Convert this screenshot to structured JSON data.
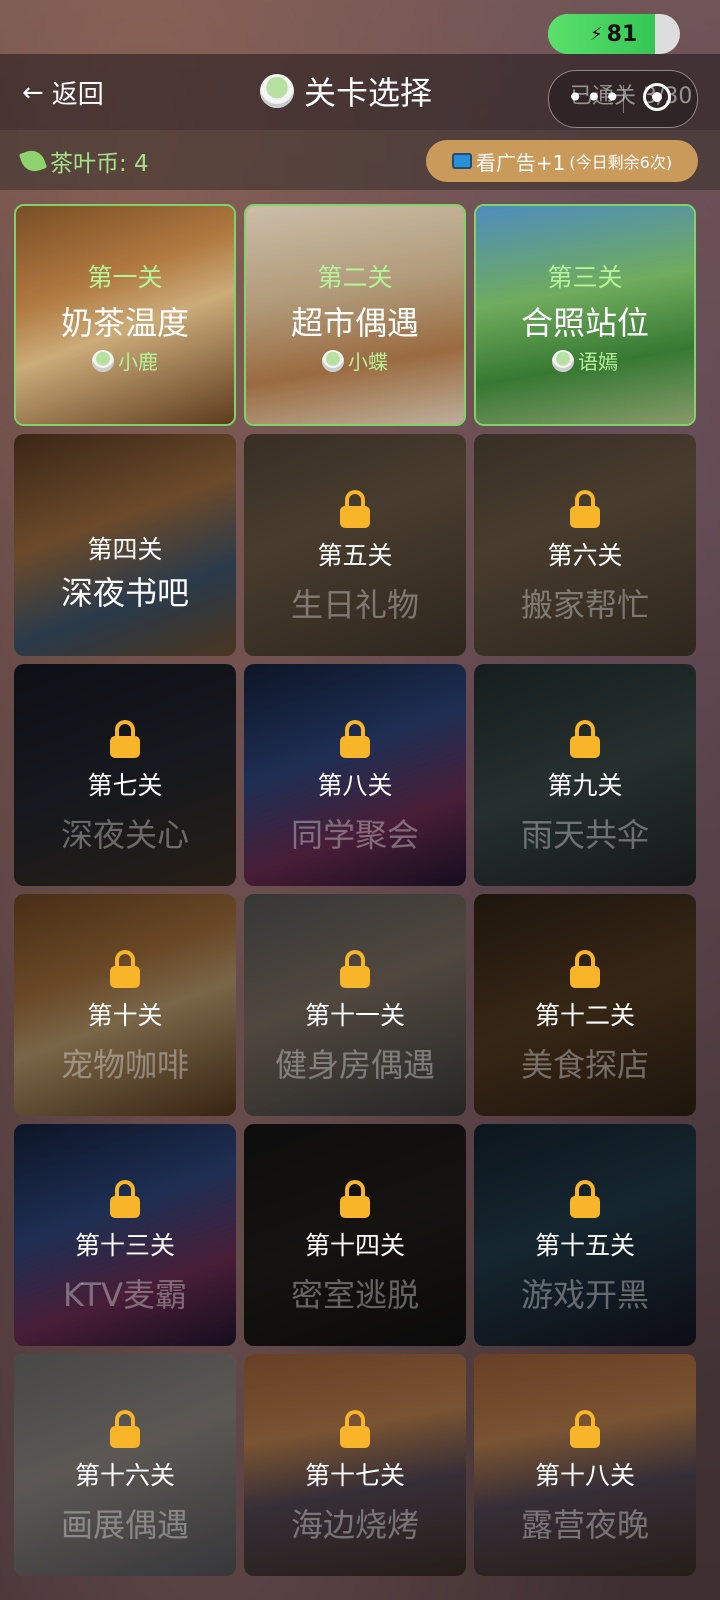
{
  "status": {
    "battery": "81",
    "battery_level": 0.81
  },
  "header": {
    "back_label": "返回",
    "back_icon": "arrow-left-icon",
    "title": "关卡选择",
    "progress": "已通关 3/30",
    "more_icon": "more-dots-icon",
    "target_icon": "miniprogram-close-icon"
  },
  "subbar": {
    "coins": "茶叶币: 4",
    "ad_label": "看广告+1",
    "ad_note": "(今日剩余6次)"
  },
  "levels": [
    {
      "num": "第一关",
      "name": "奶茶温度",
      "char": "小鹿",
      "state": "unlocked",
      "scene": "cafe-window"
    },
    {
      "num": "第二关",
      "name": "超市偶遇",
      "char": "小蝶",
      "state": "unlocked",
      "scene": "supermarket"
    },
    {
      "num": "第三关",
      "name": "合照站位",
      "char": "语嫣",
      "state": "unlocked",
      "scene": "park"
    },
    {
      "num": "第四关",
      "name": "深夜书吧",
      "state": "current",
      "scene": "night-library"
    },
    {
      "num": "第五关",
      "name": "生日礼物",
      "state": "locked",
      "scene": "living-room"
    },
    {
      "num": "第六关",
      "name": "搬家帮忙",
      "state": "locked",
      "scene": "living-room"
    },
    {
      "num": "第七关",
      "name": "深夜关心",
      "state": "locked",
      "scene": "night-room"
    },
    {
      "num": "第八关",
      "name": "同学聚会",
      "state": "locked",
      "scene": "ktv"
    },
    {
      "num": "第九关",
      "name": "雨天共伞",
      "state": "locked",
      "scene": "rain-street"
    },
    {
      "num": "第十关",
      "name": "宠物咖啡",
      "state": "locked",
      "scene": "cafe-window"
    },
    {
      "num": "第十一关",
      "name": "健身房偶遇",
      "state": "locked",
      "scene": "gym"
    },
    {
      "num": "第十二关",
      "name": "美食探店",
      "state": "locked",
      "scene": "restaurant"
    },
    {
      "num": "第十三关",
      "name": "KTV麦霸",
      "state": "locked",
      "scene": "ktv"
    },
    {
      "num": "第十四关",
      "name": "密室逃脱",
      "state": "locked",
      "scene": "escape-room"
    },
    {
      "num": "第十五关",
      "name": "游戏开黑",
      "state": "locked",
      "scene": "arcade"
    },
    {
      "num": "第十六关",
      "name": "画展偶遇",
      "state": "locked",
      "scene": "gallery"
    },
    {
      "num": "第十七关",
      "name": "海边烧烤",
      "state": "locked",
      "scene": "beach"
    },
    {
      "num": "第十八关",
      "name": "露营夜晚",
      "state": "locked",
      "scene": "beach"
    }
  ],
  "colors": {
    "accent_green": "#7ed36a",
    "lock": "#f8b52a",
    "ad_button": "#c99a5a"
  }
}
